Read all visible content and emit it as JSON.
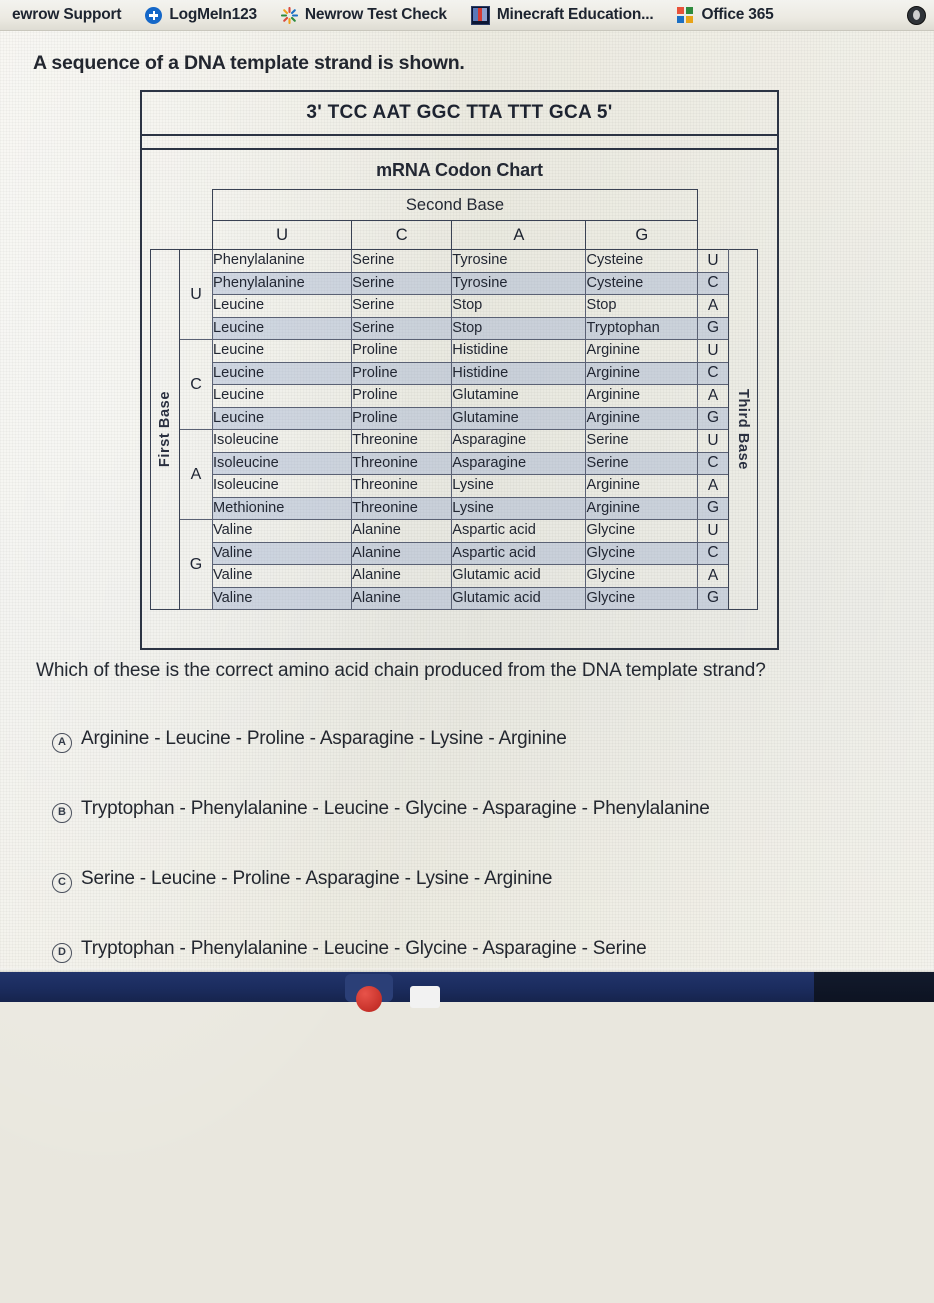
{
  "browser": {
    "bookmarks": [
      {
        "label": "ewrow Support",
        "icon": "none"
      },
      {
        "label": "LogMeIn123",
        "icon": "plus-circle-icon"
      },
      {
        "label": "Newrow Test Check",
        "icon": "sparkle-icon"
      },
      {
        "label": "Minecraft Education...",
        "icon": "minecraft-icon"
      },
      {
        "label": "Office 365",
        "icon": "microsoft-icon"
      }
    ],
    "profile_icon": "profile-avatar-icon"
  },
  "stem": "A sequence of a DNA template strand is shown.",
  "figure": {
    "sequence": "3' TCC AAT GGC TTA TTT GCA 5'",
    "chart_title": "mRNA Codon Chart",
    "first_base_label": "First Base",
    "second_base_label": "Second Base",
    "third_base_label": "Third Base",
    "second_bases": [
      "U",
      "C",
      "A",
      "G"
    ],
    "third_bases": [
      "U",
      "C",
      "A",
      "G"
    ],
    "blocks": [
      {
        "first_base": "U",
        "rows": [
          {
            "third": "U",
            "cells": [
              "Phenylalanine",
              "Serine",
              "Tyrosine",
              "Cysteine"
            ]
          },
          {
            "third": "C",
            "cells": [
              "Phenylalanine",
              "Serine",
              "Tyrosine",
              "Cysteine"
            ]
          },
          {
            "third": "A",
            "cells": [
              "Leucine",
              "Serine",
              "Stop",
              "Stop"
            ]
          },
          {
            "third": "G",
            "cells": [
              "Leucine",
              "Serine",
              "Stop",
              "Tryptophan"
            ]
          }
        ]
      },
      {
        "first_base": "C",
        "rows": [
          {
            "third": "U",
            "cells": [
              "Leucine",
              "Proline",
              "Histidine",
              "Arginine"
            ]
          },
          {
            "third": "C",
            "cells": [
              "Leucine",
              "Proline",
              "Histidine",
              "Arginine"
            ]
          },
          {
            "third": "A",
            "cells": [
              "Leucine",
              "Proline",
              "Glutamine",
              "Arginine"
            ]
          },
          {
            "third": "G",
            "cells": [
              "Leucine",
              "Proline",
              "Glutamine",
              "Arginine"
            ]
          }
        ]
      },
      {
        "first_base": "A",
        "rows": [
          {
            "third": "U",
            "cells": [
              "Isoleucine",
              "Threonine",
              "Asparagine",
              "Serine"
            ]
          },
          {
            "third": "C",
            "cells": [
              "Isoleucine",
              "Threonine",
              "Asparagine",
              "Serine"
            ]
          },
          {
            "third": "A",
            "cells": [
              "Isoleucine",
              "Threonine",
              "Lysine",
              "Arginine"
            ]
          },
          {
            "third": "G",
            "cells": [
              "Methionine",
              "Threonine",
              "Lysine",
              "Arginine"
            ]
          }
        ]
      },
      {
        "first_base": "G",
        "rows": [
          {
            "third": "U",
            "cells": [
              "Valine",
              "Alanine",
              "Aspartic acid",
              "Glycine"
            ]
          },
          {
            "third": "C",
            "cells": [
              "Valine",
              "Alanine",
              "Aspartic acid",
              "Glycine"
            ]
          },
          {
            "third": "A",
            "cells": [
              "Valine",
              "Alanine",
              "Glutamic acid",
              "Glycine"
            ]
          },
          {
            "third": "G",
            "cells": [
              "Valine",
              "Alanine",
              "Glutamic acid",
              "Glycine"
            ]
          }
        ]
      }
    ]
  },
  "question": "Which of these is the correct amino acid chain produced from the DNA template strand?",
  "options": [
    {
      "letter": "A",
      "text": "Arginine - Leucine - Proline - Asparagine - Lysine - Arginine"
    },
    {
      "letter": "B",
      "text": "Tryptophan - Phenylalanine - Leucine - Glycine - Asparagine - Phenylalanine"
    },
    {
      "letter": "C",
      "text": "Serine - Leucine - Proline - Asparagine - Lysine - Arginine"
    },
    {
      "letter": "D",
      "text": "Tryptophan - Phenylalanine - Leucine - Glycine - Asparagine - Serine"
    }
  ],
  "colors": {
    "page_bg": "#e9e7de",
    "text": "#23272f",
    "table_border": "#5a6174",
    "row_shade": "#96a8cc",
    "taskbar": "#1b2c5e"
  }
}
